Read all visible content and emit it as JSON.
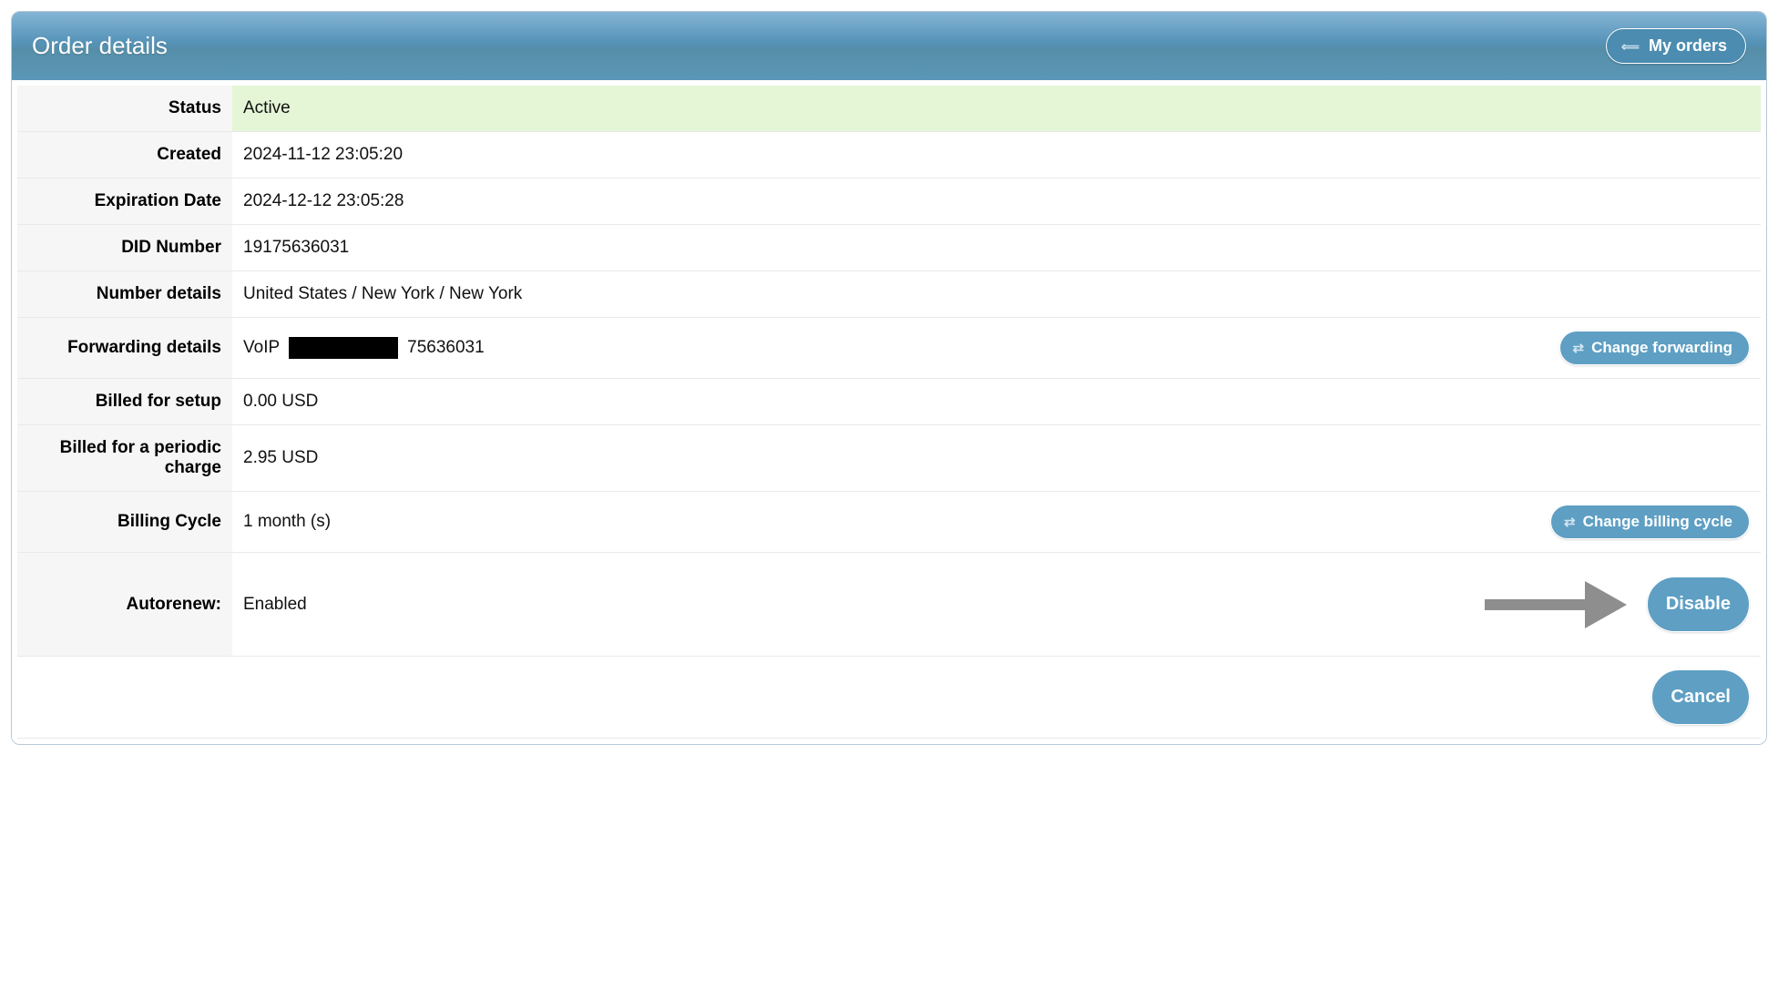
{
  "header": {
    "title": "Order details",
    "my_orders_label": "My orders"
  },
  "rows": {
    "status": {
      "label": "Status",
      "value": "Active"
    },
    "created": {
      "label": "Created",
      "value": "2024-11-12 23:05:20"
    },
    "expiration": {
      "label": "Expiration Date",
      "value": "2024-12-12 23:05:28"
    },
    "did": {
      "label": "DID Number",
      "value": "19175636031"
    },
    "number_details": {
      "label": "Number details",
      "value": "United States / New York / New York"
    },
    "forwarding": {
      "label": "Forwarding details",
      "prefix": "VoIP",
      "suffix": "75636031",
      "button": "Change forwarding"
    },
    "billed_setup": {
      "label": "Billed for setup",
      "value": "0.00 USD"
    },
    "billed_periodic": {
      "label": "Billed for a periodic charge",
      "value": "2.95 USD"
    },
    "billing_cycle": {
      "label": "Billing Cycle",
      "value": "1 month (s)",
      "button": "Change billing cycle"
    },
    "autorenew": {
      "label": "Autorenew:",
      "value": "Enabled",
      "button": "Disable"
    }
  },
  "footer": {
    "cancel_label": "Cancel"
  },
  "colors": {
    "header_gradient_top": "#85b5d6",
    "header_gradient_bottom": "#5a97b8",
    "button_bg": "#5e9fc3",
    "status_bg": "#e4f6d6",
    "row_header_bg": "#f6f6f6",
    "arrow_color": "#8e8e8e"
  }
}
